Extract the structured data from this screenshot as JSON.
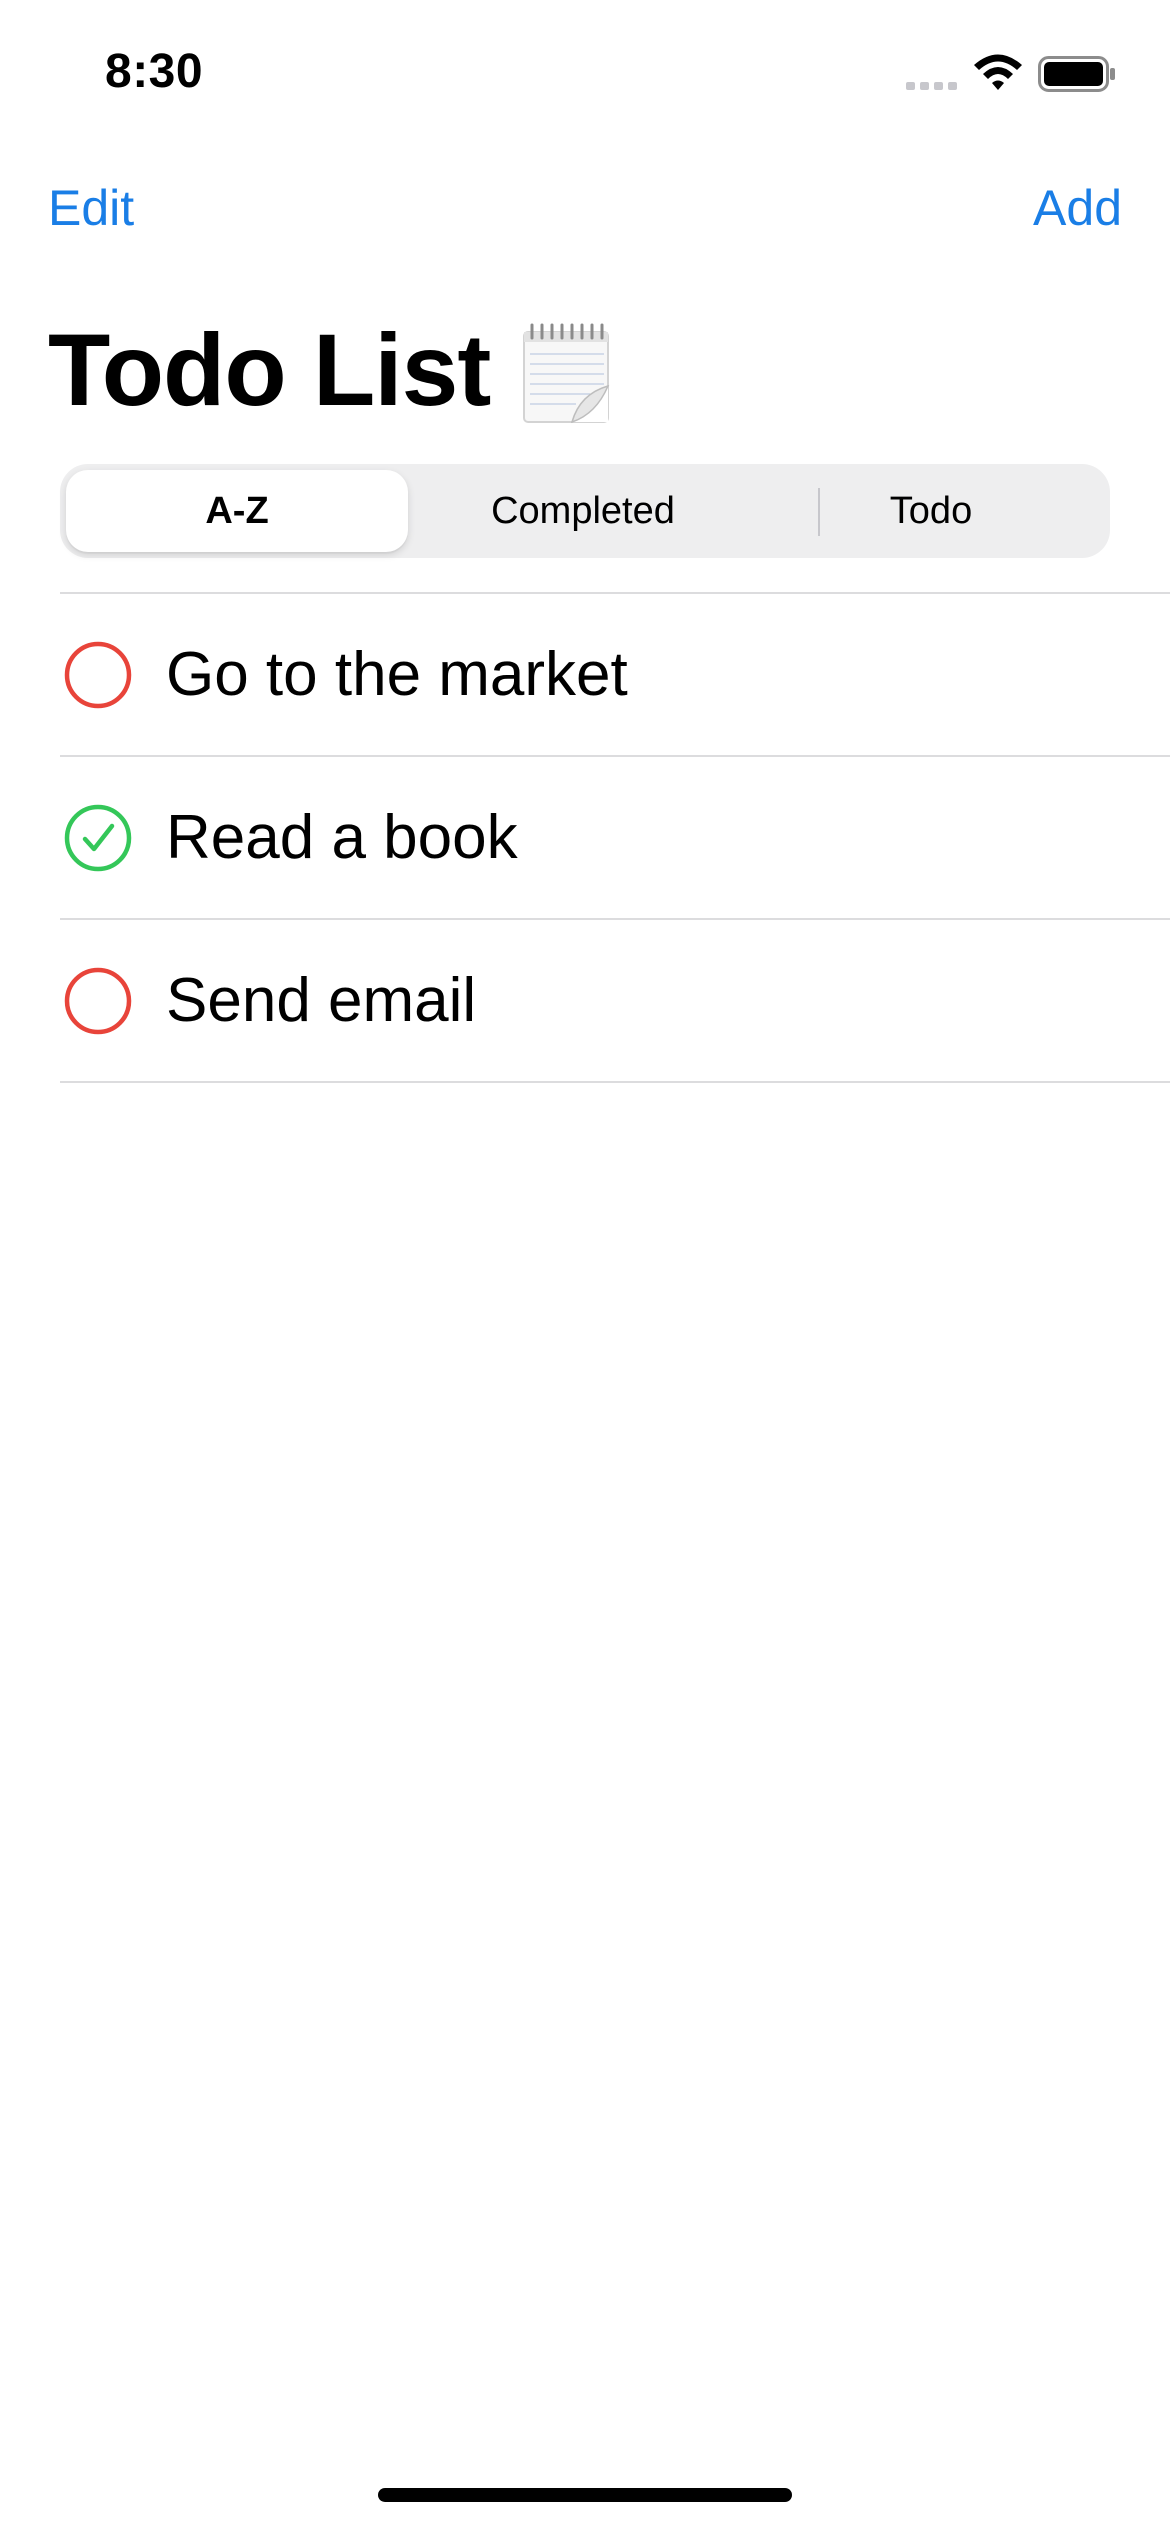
{
  "status_bar": {
    "time": "8:30",
    "icons": [
      "cellular-signal-icon",
      "wifi-icon",
      "battery-icon"
    ]
  },
  "nav": {
    "edit_label": "Edit",
    "add_label": "Add",
    "title": "Todo List",
    "title_icon": "notepad-icon"
  },
  "segmented": {
    "options": [
      "A-Z",
      "Completed",
      "Todo"
    ],
    "selected": "A-Z"
  },
  "todos": [
    {
      "title": "Go to the market",
      "completed": false
    },
    {
      "title": "Read a book",
      "completed": true
    },
    {
      "title": "Send email",
      "completed": false
    }
  ],
  "colors": {
    "accent": "#1a7ee6",
    "incomplete": "#e8443a",
    "complete": "#34c759",
    "segment_bg": "#eeeeef"
  }
}
